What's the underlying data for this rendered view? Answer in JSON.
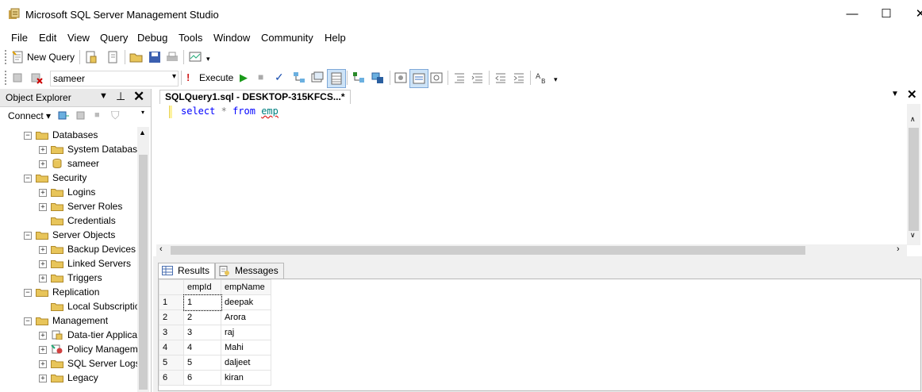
{
  "window": {
    "title": "Microsoft SQL Server Management Studio",
    "minimize": "—",
    "maximize": "☐",
    "close": "✕"
  },
  "menu": [
    "File",
    "Edit",
    "View",
    "Query",
    "Debug",
    "Tools",
    "Window",
    "Community",
    "Help"
  ],
  "toolbar1": {
    "new_query_label": "New Query"
  },
  "toolbar2": {
    "database": "sameer",
    "execute_label": "Execute"
  },
  "object_explorer": {
    "title": "Object Explorer",
    "connect_label": "Connect",
    "tree": [
      {
        "label": "Databases",
        "level": 1,
        "expanded": true,
        "icon": "folder"
      },
      {
        "label": "System Databases",
        "level": 2,
        "expanded": false,
        "icon": "folder"
      },
      {
        "label": "sameer",
        "level": 2,
        "expanded": false,
        "icon": "database"
      },
      {
        "label": "Security",
        "level": 1,
        "expanded": true,
        "icon": "folder"
      },
      {
        "label": "Logins",
        "level": 2,
        "expanded": false,
        "icon": "folder"
      },
      {
        "label": "Server Roles",
        "level": 2,
        "expanded": false,
        "icon": "folder"
      },
      {
        "label": "Credentials",
        "level": 2,
        "expanded": null,
        "icon": "folder"
      },
      {
        "label": "Server Objects",
        "level": 1,
        "expanded": true,
        "icon": "folder"
      },
      {
        "label": "Backup Devices",
        "level": 2,
        "expanded": false,
        "icon": "folder"
      },
      {
        "label": "Linked Servers",
        "level": 2,
        "expanded": false,
        "icon": "folder"
      },
      {
        "label": "Triggers",
        "level": 2,
        "expanded": false,
        "icon": "folder"
      },
      {
        "label": "Replication",
        "level": 1,
        "expanded": true,
        "icon": "folder"
      },
      {
        "label": "Local Subscriptions",
        "level": 2,
        "expanded": null,
        "icon": "folder"
      },
      {
        "label": "Management",
        "level": 1,
        "expanded": true,
        "icon": "folder"
      },
      {
        "label": "Data-tier Applications",
        "level": 2,
        "expanded": false,
        "icon": "app"
      },
      {
        "label": "Policy Management",
        "level": 2,
        "expanded": false,
        "icon": "policy"
      },
      {
        "label": "SQL Server Logs",
        "level": 2,
        "expanded": false,
        "icon": "folder"
      },
      {
        "label": "Legacy",
        "level": 2,
        "expanded": false,
        "icon": "folder"
      }
    ]
  },
  "editor": {
    "tab_title": "SQLQuery1.sql - DESKTOP-315KFCS...*",
    "code": {
      "kw1": "select",
      "star": "*",
      "kw2": "from",
      "table": "emp"
    }
  },
  "results": {
    "tabs": [
      "Results",
      "Messages"
    ],
    "columns": [
      "empId",
      "empName"
    ],
    "rows": [
      [
        "1",
        "1",
        "deepak"
      ],
      [
        "2",
        "2",
        "Arora"
      ],
      [
        "3",
        "3",
        "raj"
      ],
      [
        "4",
        "4",
        "Mahi"
      ],
      [
        "5",
        "5",
        "daljeet"
      ],
      [
        "6",
        "6",
        "kiran"
      ]
    ]
  },
  "colors": {
    "folder": "#e8c55a",
    "accent_tab": "#f5cc84",
    "keyword": "#0000ff"
  }
}
